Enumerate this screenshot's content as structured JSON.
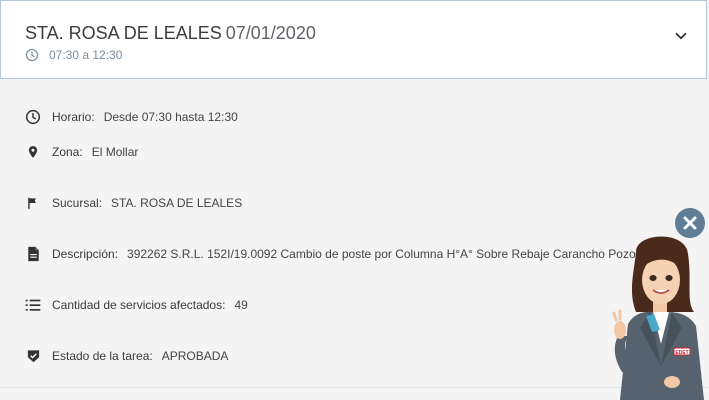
{
  "header": {
    "title": "STA. ROSA DE LEALES",
    "date": "07/01/2020",
    "time_range": "07:30 a 12:30",
    "icons": {
      "time": "clock-icon",
      "toggle": "chevron-down-icon"
    }
  },
  "details": [
    {
      "icon": "clock-icon",
      "label": "Horario:",
      "value": "Desde 07:30 hasta 12:30"
    },
    {
      "icon": "location-pin-icon",
      "label": "Zona:",
      "value": "El Mollar"
    },
    {
      "icon": "flag-icon",
      "label": "Sucursal:",
      "value": "STA. ROSA DE LEALES"
    },
    {
      "icon": "document-icon",
      "label": "Descripción:",
      "value": "392262 S.R.L. 152I/19.0092 Cambio de poste por Columna H°A° Sobre Rebaje Carancho Pozo"
    },
    {
      "icon": "list-icon",
      "label": "Cantidad de servicios afectados:",
      "value": "49"
    },
    {
      "icon": "shield-check-icon",
      "label": "Estado de la tarea:",
      "value": "APROBADA"
    }
  ],
  "assistant": {
    "close_icon": "close-icon",
    "badge_text": "EDET"
  },
  "colors": {
    "header_border": "#b3c6dd",
    "background": "#f4f4f4",
    "close_button": "#5f7d95"
  }
}
